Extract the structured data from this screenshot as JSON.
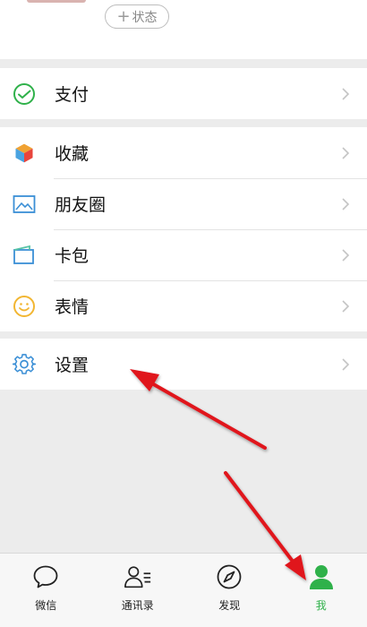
{
  "profile": {
    "status_label": "状态"
  },
  "menu": {
    "pay": "支付",
    "favorites": "收藏",
    "moments": "朋友圈",
    "cards": "卡包",
    "stickers": "表情",
    "settings": "设置"
  },
  "tabbar": {
    "chats": "微信",
    "contacts": "通讯录",
    "discover": "发现",
    "me": "我"
  },
  "colors": {
    "accent_green": "#2fb14a",
    "arrow_red": "#e0121a",
    "background": "#ececec"
  }
}
